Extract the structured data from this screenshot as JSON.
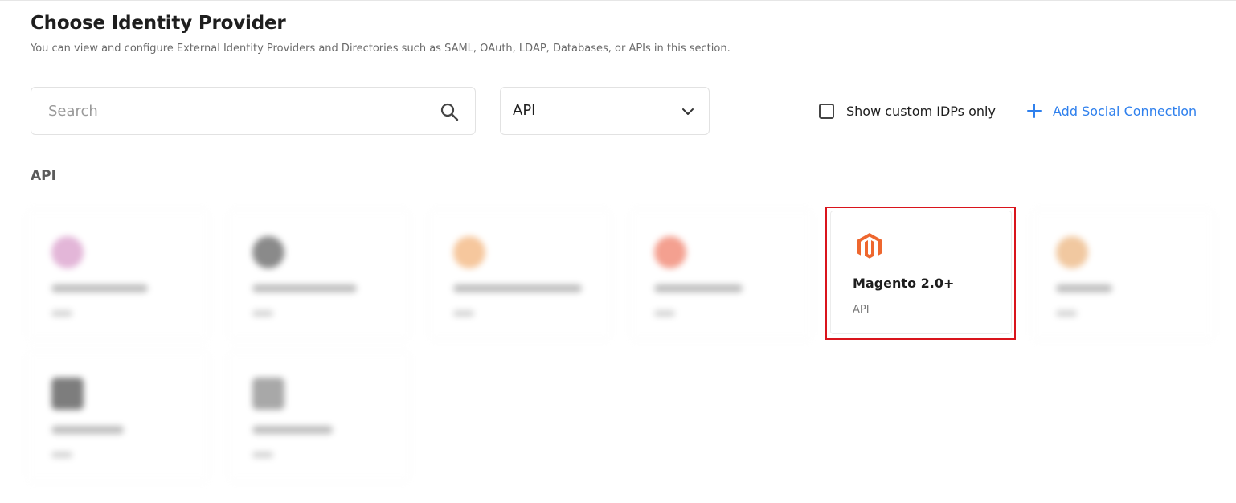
{
  "header": {
    "title": "Choose Identity Provider",
    "subtitle": "You can view and configure External Identity Providers and Directories such as SAML, OAuth, LDAP, Databases, or APIs in this section."
  },
  "search": {
    "placeholder": "Search",
    "value": ""
  },
  "filter": {
    "selected": "API"
  },
  "custom_toggle": {
    "label": "Show custom IDPs only",
    "checked": false
  },
  "add_social": {
    "label": "Add Social Connection",
    "color": "#2f80ed"
  },
  "section": {
    "heading": "API"
  },
  "highlighted_card": {
    "name": "Magento 2.0+",
    "type": "API",
    "icon": "magento-logo-icon",
    "brand_color": "#ee672f"
  },
  "blurred_cards": [
    {
      "icon_color": "#e3b6d8"
    },
    {
      "icon_color": "#8a8a8a"
    },
    {
      "icon_color": "#f6c79d"
    },
    {
      "icon_color": "#f4a090"
    },
    {
      "icon_color": "#f1c8a0"
    },
    {
      "icon_color": "#7d7d7d"
    },
    {
      "icon_color": "#a8a8a8"
    }
  ],
  "colors": {
    "highlight_border": "#d9141c",
    "accent": "#2f80ed"
  }
}
